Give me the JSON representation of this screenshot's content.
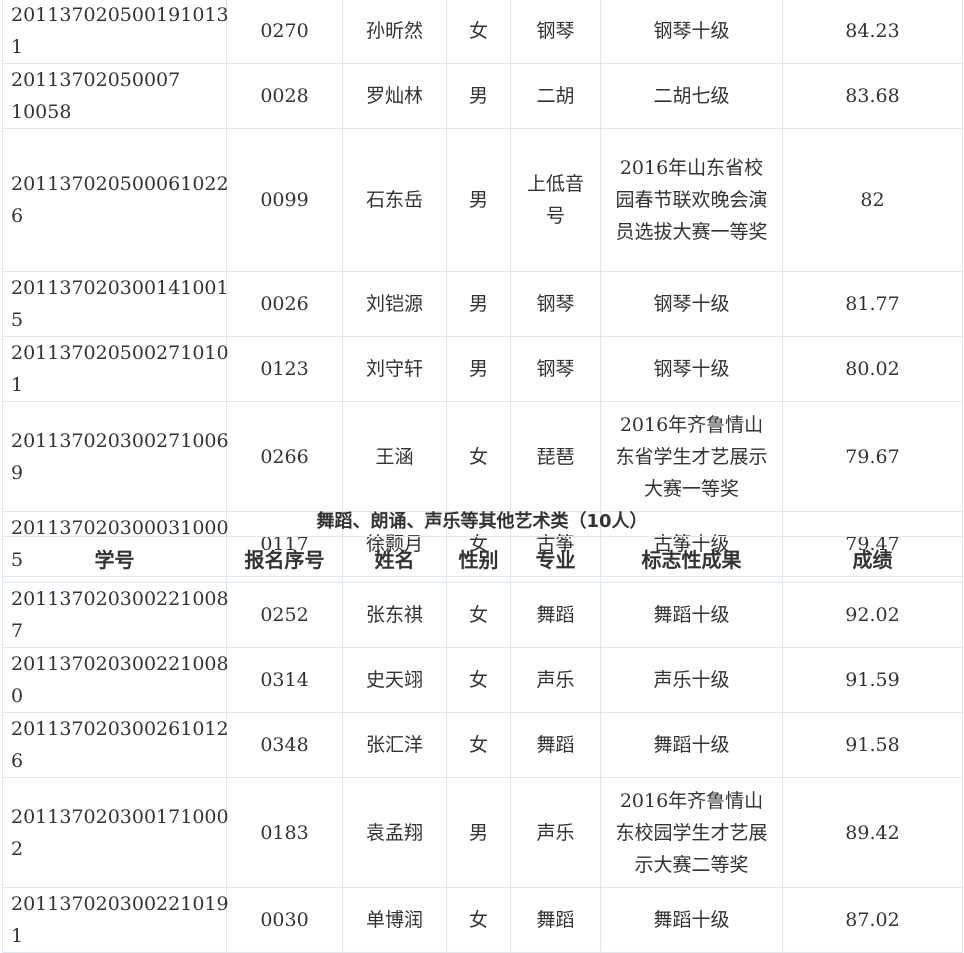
{
  "table1": {
    "rows": [
      {
        "id": "201137020500191013​1",
        "seq": "0270",
        "name": "孙昕然",
        "gender": "女",
        "major": "钢琴",
        "achievement": "钢琴十级",
        "score": "84.23"
      },
      {
        "id": "20113702050007​10058",
        "seq": "0028",
        "name": "罗灿林",
        "gender": "男",
        "major": "二胡",
        "achievement": "二胡七级",
        "score": "83.68"
      },
      {
        "id": "201137020500061022​6",
        "seq": "0099",
        "name": "石东岳",
        "gender": "男",
        "major": "上低音号",
        "achievement": "2016年山东省校园春节联欢晚会演员选拔大赛一等奖",
        "score": "82"
      },
      {
        "id": "201137020300141001​5",
        "seq": "0026",
        "name": "刘铠源",
        "gender": "男",
        "major": "钢琴",
        "achievement": "钢琴十级",
        "score": "81.77"
      },
      {
        "id": "201137020500271010​1",
        "seq": "0123",
        "name": "刘守轩",
        "gender": "男",
        "major": "钢琴",
        "achievement": "钢琴十级",
        "score": "80.02"
      },
      {
        "id": "201137020300271006​9",
        "seq": "0266",
        "name": "王涵",
        "gender": "女",
        "major": "琵琶",
        "achievement": "2016年齐鲁情山东省学生才艺展示大赛一等奖",
        "score": "79.67"
      },
      {
        "id": "201137020300031000​5",
        "seq": "0117",
        "name": "徐颢月",
        "gender": "女",
        "major": "古筝",
        "achievement": "古筝十级",
        "score": "79.47"
      }
    ]
  },
  "section2": {
    "title": "舞蹈、朗诵、声乐等其他艺术类（10人）",
    "headers": {
      "id": "学号",
      "seq": "报名序号",
      "name": "姓名",
      "gender": "性别",
      "major": "专业",
      "achievement": "标志性成果",
      "score": "成绩"
    },
    "rows": [
      {
        "id": "201137020300221008​7",
        "seq": "0252",
        "name": "张东祺",
        "gender": "女",
        "major": "舞蹈",
        "achievement": "舞蹈十级",
        "score": "92.02"
      },
      {
        "id": "201137020300221008​0",
        "seq": "0314",
        "name": "史天翊",
        "gender": "女",
        "major": "声乐",
        "achievement": "声乐十级",
        "score": "91.59"
      },
      {
        "id": "201137020300261012​6",
        "seq": "0348",
        "name": "张汇洋",
        "gender": "女",
        "major": "舞蹈",
        "achievement": "舞蹈十级",
        "score": "91.58"
      },
      {
        "id": "201137020300171000​2",
        "seq": "0183",
        "name": "袁孟翔",
        "gender": "男",
        "major": "声乐",
        "achievement": "2016年齐鲁情山东校园学生才艺展示大赛二等奖",
        "score": "89.42"
      },
      {
        "id": "201137020300221019​1",
        "seq": "0030",
        "name": "单博润",
        "gender": "女",
        "major": "舞蹈",
        "achievement": "舞蹈十级",
        "score": "87.02"
      }
    ]
  }
}
